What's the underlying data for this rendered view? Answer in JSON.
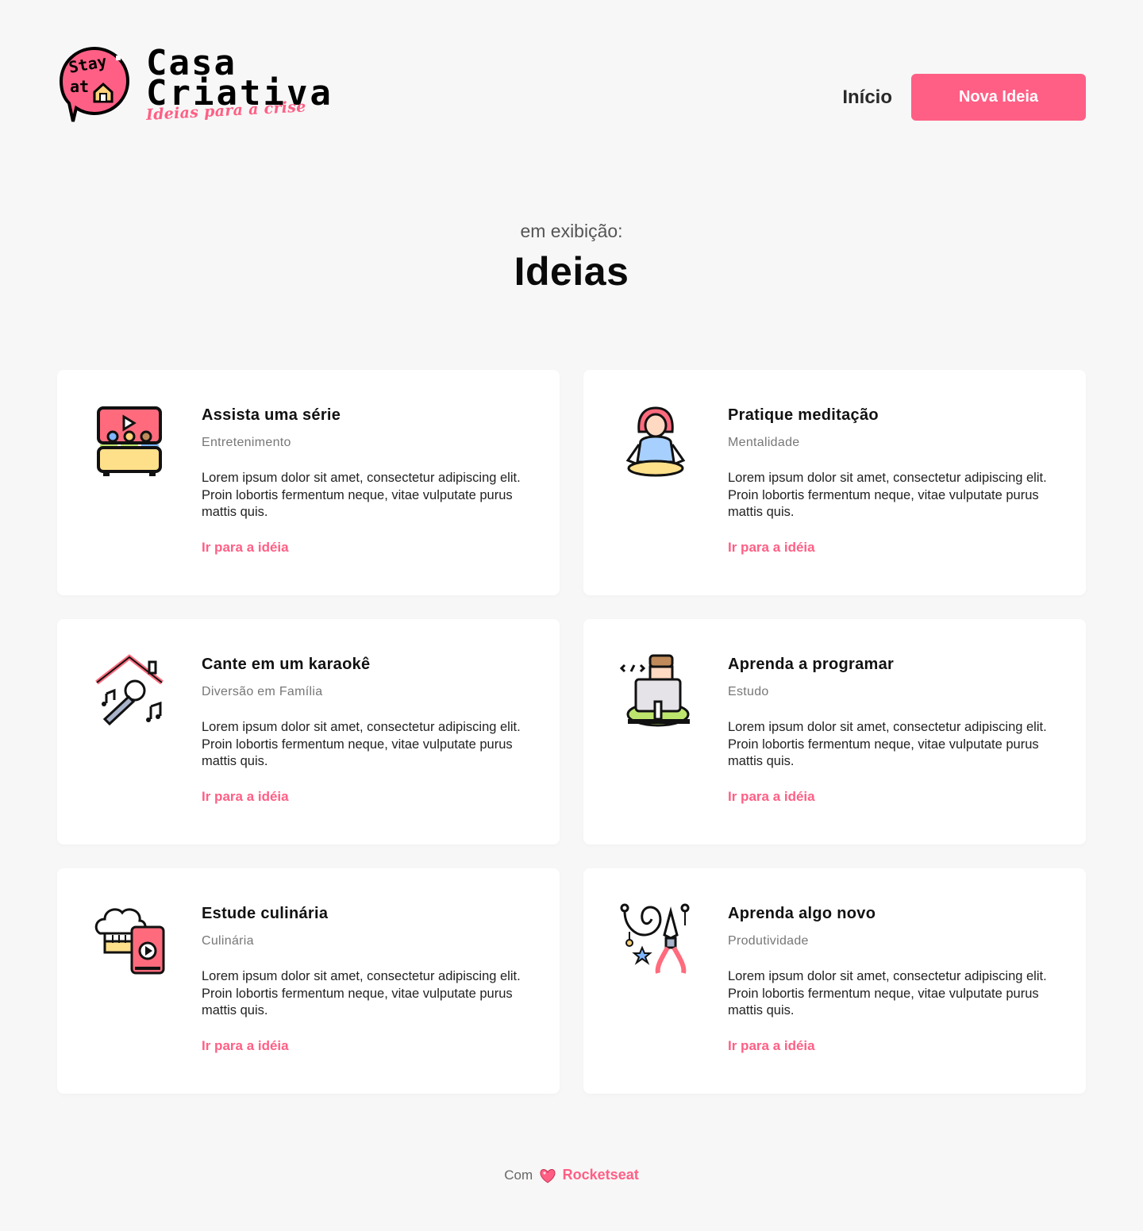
{
  "header": {
    "logo": {
      "bubble_line1": "Stay",
      "bubble_line2": "at",
      "title_line1": "Casa",
      "title_line2": "Criativa",
      "tagline": "Ideias para a crise"
    },
    "nav": {
      "home": "Início",
      "new_idea": "Nova Ideia"
    }
  },
  "hero": {
    "subtitle": "em exibição:",
    "title": "Ideias"
  },
  "cards": [
    {
      "title": "Assista uma série",
      "category": "Entretenimento",
      "description": "Lorem ipsum dolor sit amet, consectetur adipiscing elit. Proin lobortis fermentum neque, vitae vulputate purus mattis quis.",
      "link": "Ir para a idéia",
      "icon": "tv-series-icon"
    },
    {
      "title": "Pratique meditação",
      "category": "Mentalidade",
      "description": "Lorem ipsum dolor sit amet, consectetur adipiscing elit. Proin lobortis fermentum neque, vitae vulputate purus mattis quis.",
      "link": "Ir para a idéia",
      "icon": "meditation-icon"
    },
    {
      "title": "Cante em um karaokê",
      "category": "Diversão em Família",
      "description": "Lorem ipsum dolor sit amet, consectetur adipiscing elit. Proin lobortis fermentum neque, vitae vulputate purus mattis quis.",
      "link": "Ir para a idéia",
      "icon": "karaoke-icon"
    },
    {
      "title": "Aprenda a programar",
      "category": "Estudo",
      "description": "Lorem ipsum dolor sit amet, consectetur adipiscing elit. Proin lobortis fermentum neque, vitae vulputate purus mattis quis.",
      "link": "Ir para a idéia",
      "icon": "programmer-icon"
    },
    {
      "title": "Estude culinária",
      "category": "Culinária",
      "description": "Lorem ipsum dolor sit amet, consectetur adipiscing elit. Proin lobortis fermentum neque, vitae vulputate purus mattis quis.",
      "link": "Ir para a idéia",
      "icon": "cooking-icon"
    },
    {
      "title": "Aprenda algo novo",
      "category": "Produtividade",
      "description": "Lorem ipsum dolor sit amet, consectetur adipiscing elit. Proin lobortis fermentum neque, vitae vulputate purus mattis quis.",
      "link": "Ir para a idéia",
      "icon": "crafts-tools-icon"
    }
  ],
  "footer": {
    "prefix": "Com",
    "icon": "heart-icon",
    "company": "Rocketseat"
  },
  "colors": {
    "accent": "#ff5f85",
    "background": "#f7f7f7",
    "card": "#ffffff"
  }
}
